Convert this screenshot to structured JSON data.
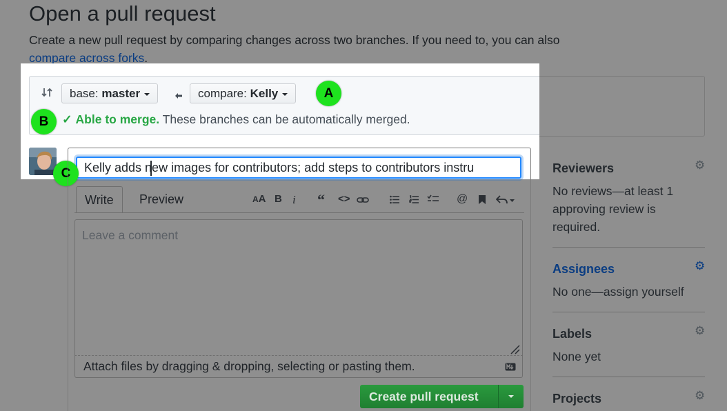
{
  "page": {
    "heading": "Open a pull request",
    "subtext": "Create a new pull request by comparing changes across two branches. If you need to, you can also",
    "fork_link": "compare across forks",
    "fork_suffix": "."
  },
  "compare": {
    "base_prefix": "base:",
    "base_branch": "master",
    "compare_prefix": "compare:",
    "compare_branch": "Kelly",
    "merge_ok": "Able to merge.",
    "merge_msg": "These branches can be automatically merged."
  },
  "markers": {
    "a": "A",
    "b": "B",
    "c": "C"
  },
  "form": {
    "title_value": "Kelly adds new images for contributors; add steps to contributors instru",
    "tabs": [
      {
        "label": "Write"
      },
      {
        "label": "Preview"
      }
    ],
    "toolbar": [
      "header-icon",
      "bold-icon",
      "italic-icon",
      "quote-icon",
      "code-icon",
      "link-icon",
      "bullet-list-icon",
      "numbered-list-icon",
      "task-list-icon",
      "mention-icon",
      "reference-icon",
      "reply-icon"
    ],
    "comment_placeholder": "Leave a comment",
    "attach_text": "Attach files by dragging & dropping, selecting or pasting them.",
    "create_label": "Create pull request"
  },
  "sidebar": {
    "reviewers": {
      "title": "Reviewers",
      "text": [
        "No reviews—at least 1",
        "approving review is",
        "required."
      ]
    },
    "assignees": {
      "title": "Assignees",
      "text": "No one—assign yourself"
    },
    "labels": {
      "title": "Labels",
      "text": "None yet"
    },
    "projects": {
      "title": "Projects"
    }
  },
  "colors": {
    "accent_green": "#28a745",
    "marker_green": "#1ee21e",
    "link_blue": "#0366d6",
    "focus_blue": "#2188ff"
  }
}
